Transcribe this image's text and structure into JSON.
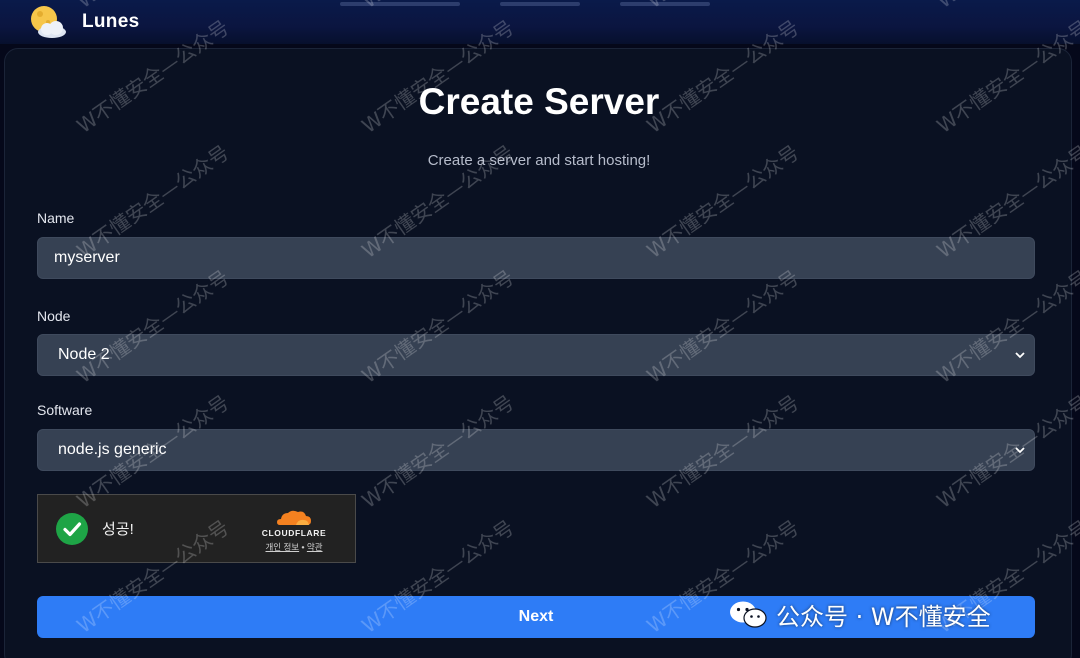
{
  "app": {
    "title": "Lunes",
    "logo_icon": "moon-cloud-icon"
  },
  "form": {
    "title": "Create Server",
    "subtitle": "Create a server and start hosting!",
    "name": {
      "label": "Name",
      "value": "myserver"
    },
    "node": {
      "label": "Node",
      "value": "Node 2"
    },
    "software": {
      "label": "Software",
      "value": "node.js generic"
    }
  },
  "captcha": {
    "status": "성공!",
    "brand": "CLOUDFLARE",
    "privacy": "개인 정보",
    "separator": "•",
    "terms": "약관",
    "check_color": "#1ea446",
    "brand_color": "#f48120"
  },
  "next_button": {
    "label": "Next",
    "color": "#2e7cf6"
  },
  "overlay": {
    "wechat_caption": "公众号 · W不懂安全",
    "watermark_text": "W不懂安全—公众号"
  }
}
